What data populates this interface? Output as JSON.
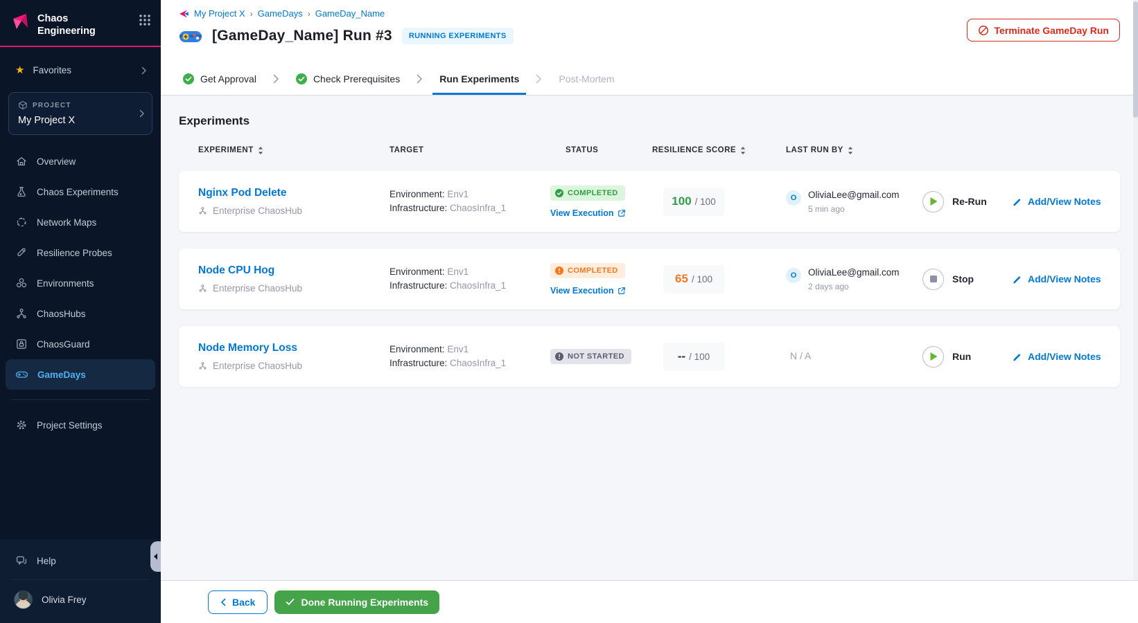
{
  "colors": {
    "brand_pink": "#e6156f",
    "accent_blue": "#0278d5",
    "success_green": "#2f9e44",
    "warning_orange": "#f47721",
    "terminate_red": "#da291c",
    "done_button_green": "#45a34a",
    "sidebar_bg": "#0a1627",
    "active_nav_text": "#4eb0f0"
  },
  "sidebar": {
    "brand": "Chaos\nEngineering",
    "favorites": "Favorites",
    "project_label": "PROJECT",
    "project_name": "My Project X",
    "items": [
      {
        "label": "Overview"
      },
      {
        "label": "Chaos Experiments"
      },
      {
        "label": "Network Maps"
      },
      {
        "label": "Resilience Probes"
      },
      {
        "label": "Environments"
      },
      {
        "label": "ChaosHubs"
      },
      {
        "label": "ChaosGuard"
      },
      {
        "label": "GameDays"
      }
    ],
    "project_settings": "Project Settings",
    "help": "Help",
    "user": "Olivia Frey"
  },
  "header": {
    "breadcrumb": {
      "project": "My Project X",
      "section": "GameDays",
      "page": "GameDay_Name"
    },
    "title": "[GameDay_Name] Run #3",
    "run_status": "RUNNING EXPERIMENTS",
    "terminate": "Terminate GameDay Run"
  },
  "stepper": [
    {
      "label": "Get Approval",
      "state": "done"
    },
    {
      "label": "Check Prerequisites",
      "state": "done"
    },
    {
      "label": "Run Experiments",
      "state": "active"
    },
    {
      "label": "Post-Mortem",
      "state": "upcoming"
    }
  ],
  "experiments": {
    "heading": "Experiments",
    "columns": {
      "experiment": "EXPERIMENT",
      "target": "TARGET",
      "status": "STATUS",
      "score": "RESILIENCE SCORE",
      "last_run": "LAST RUN BY"
    },
    "rows": [
      {
        "name": "Nginx Pod Delete",
        "hub": "Enterprise ChaosHub",
        "env_label": "Environment:",
        "env": "Env1",
        "infra_label": "Infrastructure:",
        "infra": "ChaosInfra_1",
        "status": "COMPLETED",
        "status_kind": "success",
        "view_execution": "View Execution",
        "score": "100",
        "score_kind": "success",
        "score_max": "/ 100",
        "user_initial": "O",
        "user": "OliviaLee@gmail.com",
        "time": "5 min ago",
        "action": "Re-Run",
        "notes": "Add/View Notes"
      },
      {
        "name": "Node CPU Hog",
        "hub": "Enterprise ChaosHub",
        "env_label": "Environment:",
        "env": "Env1",
        "infra_label": "Infrastructure:",
        "infra": "ChaosInfra_1",
        "status": "COMPLETED",
        "status_kind": "warning",
        "view_execution": "View Execution",
        "score": "65",
        "score_kind": "warning",
        "score_max": "/ 100",
        "user_initial": "O",
        "user": "OliviaLee@gmail.com",
        "time": "2 days ago",
        "action": "Stop",
        "notes": "Add/View Notes"
      },
      {
        "name": "Node Memory Loss",
        "hub": "Enterprise ChaosHub",
        "env_label": "Environment:",
        "env": "Env1",
        "infra_label": "Infrastructure:",
        "infra": "ChaosInfra_1",
        "status": "NOT STARTED",
        "status_kind": "neutral",
        "score": "--",
        "score_kind": "none",
        "score_max": "/ 100",
        "last_run_na": "N / A",
        "action": "Run",
        "notes": "Add/View Notes"
      }
    ]
  },
  "footer": {
    "back": "Back",
    "done": "Done Running Experiments"
  }
}
